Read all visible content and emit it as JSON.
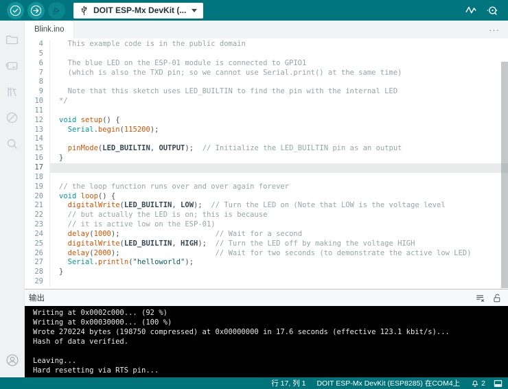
{
  "toolbar": {
    "board_selector_label": "DOIT ESP-Mx DevKit (..."
  },
  "tabs": {
    "active_tab": "Blink.ino",
    "more_label": "···"
  },
  "sidebar_icons": [
    "sketchbook-folder",
    "boards-manager",
    "library-manager",
    "debug",
    "search",
    "account"
  ],
  "editor": {
    "lines": [
      {
        "n": 4,
        "seg": [
          [
            "cm",
            "  This example code is in the public domain"
          ]
        ]
      },
      {
        "n": 5,
        "seg": []
      },
      {
        "n": 6,
        "seg": [
          [
            "cm",
            "  The blue LED on the ESP-01 module is connected to GPIO1"
          ]
        ]
      },
      {
        "n": 7,
        "seg": [
          [
            "cm",
            "  (which is also the TXD pin; so we cannot use Serial.print() at the same time)"
          ]
        ]
      },
      {
        "n": 8,
        "seg": []
      },
      {
        "n": 9,
        "seg": [
          [
            "cm",
            "  Note that this sketch uses LED_BUILTIN to find the pin with the internal LED"
          ]
        ]
      },
      {
        "n": 10,
        "seg": [
          [
            "cm",
            "*/"
          ]
        ]
      },
      {
        "n": 11,
        "seg": []
      },
      {
        "n": 12,
        "seg": [
          [
            "kw",
            "void"
          ],
          [
            "pl",
            " "
          ],
          [
            "fn",
            "setup"
          ],
          [
            "pl",
            "() {"
          ]
        ]
      },
      {
        "n": 13,
        "seg": [
          [
            "pl",
            "  "
          ],
          [
            "kw",
            "Serial"
          ],
          [
            "pl",
            "."
          ],
          [
            "fn",
            "begin"
          ],
          [
            "pl",
            "("
          ],
          [
            "num",
            "115200"
          ],
          [
            "pl",
            ");"
          ]
        ]
      },
      {
        "n": 14,
        "seg": []
      },
      {
        "n": 15,
        "seg": [
          [
            "pl",
            "  "
          ],
          [
            "fn",
            "pinMode"
          ],
          [
            "pl",
            "("
          ],
          [
            "cs",
            "LED_BUILTIN"
          ],
          [
            "pl",
            ", "
          ],
          [
            "cs",
            "OUTPUT"
          ],
          [
            "pl",
            ");  "
          ],
          [
            "cm",
            "// Initialize the LED_BUILTIN pin as an output"
          ]
        ]
      },
      {
        "n": 16,
        "seg": [
          [
            "pl",
            "}"
          ]
        ]
      },
      {
        "n": 17,
        "seg": [],
        "active": true
      },
      {
        "n": 18,
        "seg": []
      },
      {
        "n": 19,
        "seg": [
          [
            "cm",
            "// the loop function runs over and over again forever"
          ]
        ]
      },
      {
        "n": 20,
        "seg": [
          [
            "kw",
            "void"
          ],
          [
            "pl",
            " "
          ],
          [
            "fn",
            "loop"
          ],
          [
            "pl",
            "() {"
          ]
        ]
      },
      {
        "n": 21,
        "seg": [
          [
            "pl",
            "  "
          ],
          [
            "fn",
            "digitalWrite"
          ],
          [
            "pl",
            "("
          ],
          [
            "cs",
            "LED_BUILTIN"
          ],
          [
            "pl",
            ", "
          ],
          [
            "cs",
            "LOW"
          ],
          [
            "pl",
            ");  "
          ],
          [
            "cm",
            "// Turn the LED on (Note that LOW is the voltage level"
          ]
        ]
      },
      {
        "n": 22,
        "seg": [
          [
            "pl",
            "  "
          ],
          [
            "cm",
            "// but actually the LED is on; this is because"
          ]
        ]
      },
      {
        "n": 23,
        "seg": [
          [
            "pl",
            "  "
          ],
          [
            "cm",
            "// it is active low on the ESP-01)"
          ]
        ]
      },
      {
        "n": 24,
        "seg": [
          [
            "pl",
            "  "
          ],
          [
            "fn",
            "delay"
          ],
          [
            "pl",
            "("
          ],
          [
            "num",
            "1000"
          ],
          [
            "pl",
            ");                      "
          ],
          [
            "cm",
            "// Wait for a second"
          ]
        ]
      },
      {
        "n": 25,
        "seg": [
          [
            "pl",
            "  "
          ],
          [
            "fn",
            "digitalWrite"
          ],
          [
            "pl",
            "("
          ],
          [
            "cs",
            "LED_BUILTIN"
          ],
          [
            "pl",
            ", "
          ],
          [
            "cs",
            "HIGH"
          ],
          [
            "pl",
            ");  "
          ],
          [
            "cm",
            "// Turn the LED off by making the voltage HIGH"
          ]
        ]
      },
      {
        "n": 26,
        "seg": [
          [
            "pl",
            "  "
          ],
          [
            "fn",
            "delay"
          ],
          [
            "pl",
            "("
          ],
          [
            "num",
            "2000"
          ],
          [
            "pl",
            ");                      "
          ],
          [
            "cm",
            "// Wait for two seconds (to demonstrate the active low LED)"
          ]
        ]
      },
      {
        "n": 27,
        "seg": [
          [
            "pl",
            "  "
          ],
          [
            "kw",
            "Serial"
          ],
          [
            "pl",
            "."
          ],
          [
            "fn",
            "println"
          ],
          [
            "pl",
            "("
          ],
          [
            "str",
            "\"helloworld\""
          ],
          [
            "pl",
            ");"
          ]
        ]
      },
      {
        "n": 28,
        "seg": [
          [
            "pl",
            "}"
          ]
        ]
      },
      {
        "n": 29,
        "seg": []
      }
    ]
  },
  "output": {
    "title": "输出",
    "console_lines": [
      "Writing at 0x0002c000... (92 %)",
      "Writing at 0x00030000... (100 %)",
      "Wrote 270224 bytes (198750 compressed) at 0x00000000 in 17.6 seconds (effective 123.1 kbit/s)...",
      "Hash of data verified.",
      "",
      "Leaving...",
      "Hard resetting via RTS pin..."
    ]
  },
  "statusbar": {
    "cursor_position": "行 17, 列 1",
    "board_port": "DOIT ESP-Mx DevKit (ESP8285) 在COM4上",
    "notification_count": "2"
  },
  "colors": {
    "toolbar_teal": "#00757d",
    "button_teal": "#11949b",
    "statusbar_teal": "#00727a",
    "keyword": "#00979d",
    "function": "#d35400",
    "comment": "#95a5a6",
    "string": "#005c5f",
    "constant": "#37474f",
    "console_bg": "#010101",
    "active_line": "#e9ebeb"
  }
}
